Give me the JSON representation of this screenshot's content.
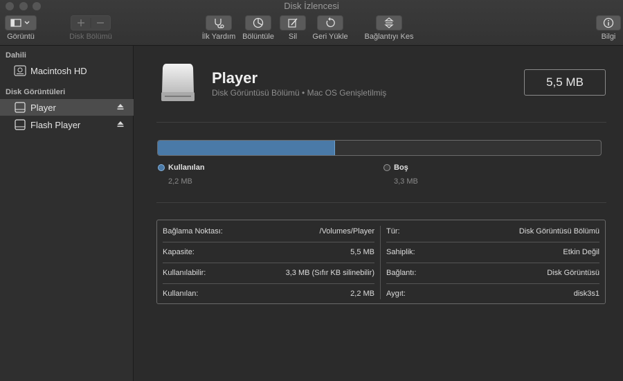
{
  "window": {
    "title": "Disk İzlencesi"
  },
  "toolbar": {
    "view_label": "Görüntü",
    "partition_label": "Disk Bölümü",
    "first_aid_label": "İlk Yardım",
    "partition2_label": "Bölüntüle",
    "erase_label": "Sil",
    "restore_label": "Geri Yükle",
    "unmount_label": "Bağlantıyı Kes",
    "info_label": "Bilgi"
  },
  "sidebar": {
    "internal_header": "Dahili",
    "images_header": "Disk Görüntüleri",
    "items": [
      {
        "label": "Macintosh HD"
      },
      {
        "label": "Player"
      },
      {
        "label": "Flash Player"
      }
    ]
  },
  "volume": {
    "name": "Player",
    "subtitle": "Disk Görüntüsü Bölümü • Mac OS Genişletilmiş",
    "size": "5,5 MB"
  },
  "usage": {
    "used_fraction": 0.4,
    "used_color": "#4a7aa8",
    "used_label": "Kullanılan",
    "used_value": "2,2 MB",
    "free_label": "Boş",
    "free_value": "3,3 MB"
  },
  "info": {
    "left": [
      {
        "key": "Bağlama Noktası:",
        "value": "/Volumes/Player"
      },
      {
        "key": "Kapasite:",
        "value": "5,5 MB"
      },
      {
        "key": "Kullanılabilir:",
        "value": "3,3 MB (Sıfır KB silinebilir)"
      },
      {
        "key": "Kullanılan:",
        "value": "2,2 MB"
      }
    ],
    "right": [
      {
        "key": "Tür:",
        "value": "Disk Görüntüsü Bölümü"
      },
      {
        "key": "Sahiplik:",
        "value": "Etkin Değil"
      },
      {
        "key": "Bağlantı:",
        "value": "Disk Görüntüsü"
      },
      {
        "key": "Aygıt:",
        "value": "disk3s1"
      }
    ]
  }
}
